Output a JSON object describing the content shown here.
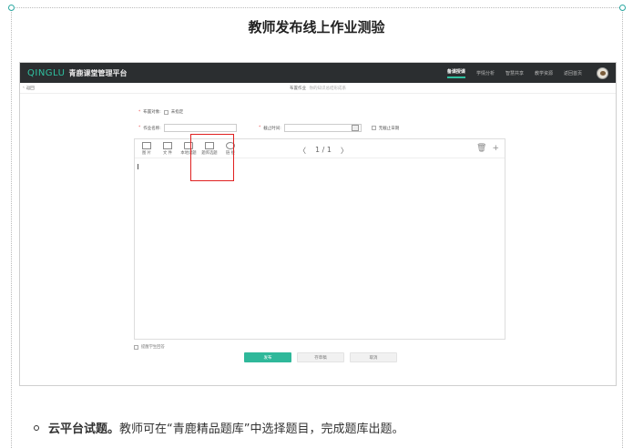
{
  "doc": {
    "title": "教师发布线上作业测验",
    "bullet_bold": "云平台试题。",
    "bullet_text": "教师可在“青鹿精品题库”中选择题目，完成题库出题。"
  },
  "app": {
    "logo": "QINGLU",
    "platform_name": "青鹿课堂管理平台",
    "nav": [
      "备课授课",
      "学情分析",
      "智慧共享",
      "教学资源",
      "返回首页"
    ],
    "back_label": "返回",
    "page_title": "布置作业",
    "page_hint": "你的知识总结形成系",
    "form": {
      "assign_label": "布置对象:",
      "assign_option": "未指定",
      "name_label": "作业名称:",
      "deadline_label": "截止时间:",
      "no_deadline_label": "无截止日期"
    },
    "toolbar": {
      "tools": [
        "图 片",
        "文 件",
        "本地试题",
        "题库选题",
        "链 接"
      ],
      "pager": "1 / 1",
      "prev": "〈",
      "next": "〉"
    },
    "notify_label": "提醒学生回答",
    "buttons": {
      "publish": "发布",
      "draft": "存草稿",
      "cancel": "取消"
    }
  },
  "colors": {
    "accent": "#2fb89a",
    "highlight": "#e02020",
    "topbar": "#2b2e30"
  }
}
